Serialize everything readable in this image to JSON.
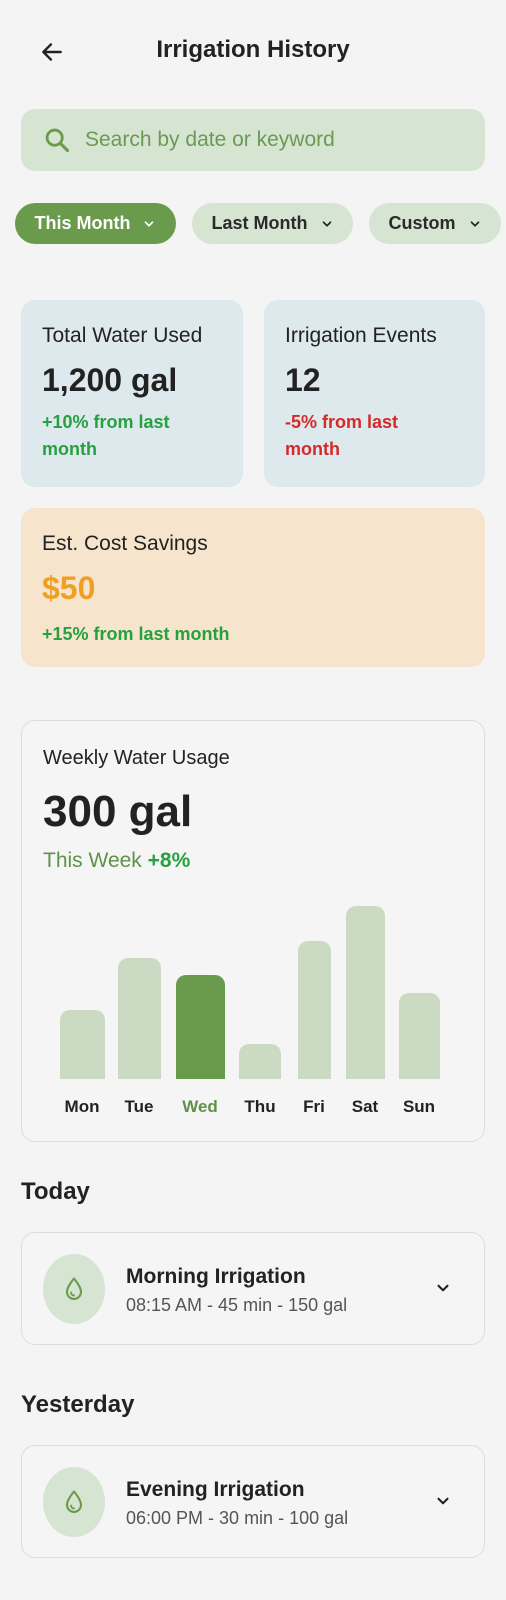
{
  "header": {
    "title": "Irrigation History",
    "back_icon": "arrow-left-icon"
  },
  "search": {
    "placeholder": "Search by date or keyword",
    "value": "",
    "icon": "search-icon"
  },
  "filters": [
    {
      "label": "This Month",
      "active": true
    },
    {
      "label": "Last Month",
      "active": false
    },
    {
      "label": "Custom",
      "active": false
    }
  ],
  "stats": {
    "water": {
      "label": "Total Water Used",
      "value": "1,200 gal",
      "change_line1": "+10% from last",
      "change_line2": "month"
    },
    "events": {
      "label": "Irrigation Events",
      "value": "12",
      "change_line1": "-5% from last",
      "change_line2": "month"
    },
    "savings": {
      "label": "Est. Cost Savings",
      "value": "$50",
      "change": "+15% from last month"
    }
  },
  "weekly": {
    "label": "Weekly Water Usage",
    "value": "300 gal",
    "period": "This Week",
    "change": "+8%"
  },
  "chart_data": {
    "type": "bar",
    "categories": [
      "Mon",
      "Tue",
      "Wed",
      "Thu",
      "Fri",
      "Sat",
      "Sun"
    ],
    "values": [
      40,
      70,
      60,
      20,
      80,
      100,
      50
    ],
    "highlighted": "Wed",
    "ylim": [
      0,
      100
    ],
    "grid": false,
    "title": "",
    "xlabel": "",
    "ylabel": ""
  },
  "sections": {
    "today": {
      "title": "Today",
      "event": {
        "title": "Morning Irrigation",
        "meta": "08:15 AM - 45 min - 150 gal",
        "icon": "water-drop-icon"
      }
    },
    "yesterday": {
      "title": "Yesterday",
      "event": {
        "title": "Evening Irrigation",
        "meta": "06:00 PM - 30 min - 100 gal",
        "icon": "water-drop-icon"
      }
    }
  },
  "colors": {
    "accent": "#6a9a4c",
    "accent_light": "#d6e4d2",
    "positive": "#27a040",
    "negative": "#d42a2a",
    "savings": "#f0a020",
    "bar_inactive": "#cbdac3"
  }
}
